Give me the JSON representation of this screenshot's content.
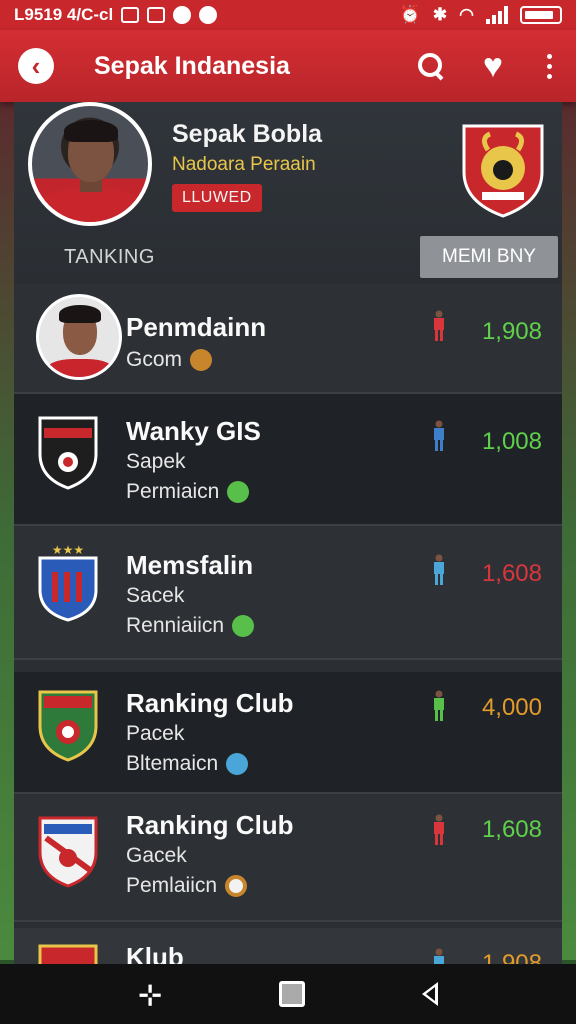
{
  "status_bar": {
    "left_text": "L9519 4/C-cl",
    "icons": [
      "sim-icon",
      "image-icon",
      "paper-plane-icon",
      "cloud-icon",
      "circle-icon"
    ],
    "right_icons": [
      "alarm-icon",
      "bluetooth-icon",
      "wifi-icon",
      "signal-icon",
      "battery-icon"
    ]
  },
  "app_bar": {
    "title": "Sepak Indanesia",
    "back_icon": "chevron-left-icon",
    "actions": [
      "search-icon",
      "heart-icon",
      "more-vertical-icon"
    ]
  },
  "profile": {
    "name": "Sepak Bobla",
    "subtitle": "Nadoara Peraain",
    "badge": "LLUWED",
    "tab_label": "TANKING",
    "menu_button": "MEMI BNY"
  },
  "rankings": [
    {
      "name": "Penmdainn",
      "line2": "Gcom",
      "line3": "",
      "score": "1,908",
      "score_color": "#5fd14a",
      "player_color": "#d8363b",
      "logo": "avatar",
      "style": "light"
    },
    {
      "name": "Wanky GIS",
      "line2": "Sapek",
      "line3": "Permiaicn",
      "score": "1,008",
      "score_color": "#5fd14a",
      "player_color": "#3d7fc9",
      "logo": "crest-black",
      "style": "dark"
    },
    {
      "name": "Memsfalin",
      "line2": "Sacek",
      "line3": "Renniaiicn",
      "score": "1,608",
      "score_color": "#d9363b",
      "player_color": "#4aa6d8",
      "logo": "crest-blue",
      "style": "light"
    },
    {
      "name": "Ranking Club",
      "line2": "Pacek",
      "line3": "Bltemaicn",
      "score": "4,000",
      "score_color": "#e39b2a",
      "player_color": "#58c04a",
      "logo": "crest-green",
      "style": "dark"
    },
    {
      "name": "Ranking Club",
      "line2": "Gacek",
      "line3": "Pemlaiicn",
      "score": "1,608",
      "score_color": "#5fd14a",
      "player_color": "#d8363b",
      "logo": "crest-red",
      "style": "light"
    },
    {
      "name": "Klub",
      "line2": "",
      "line3": "",
      "score": "1,908",
      "score_color": "#e39b2a",
      "player_color": "#4aa6d8",
      "logo": "crest-orange",
      "style": "light"
    }
  ],
  "nav_bar": {
    "icons": [
      "recent-apps-icon",
      "home-icon",
      "back-icon"
    ]
  },
  "colors": {
    "brand_red": "#c8272c",
    "panel": "#2b2f34",
    "accent_yellow": "#e8c64a"
  }
}
